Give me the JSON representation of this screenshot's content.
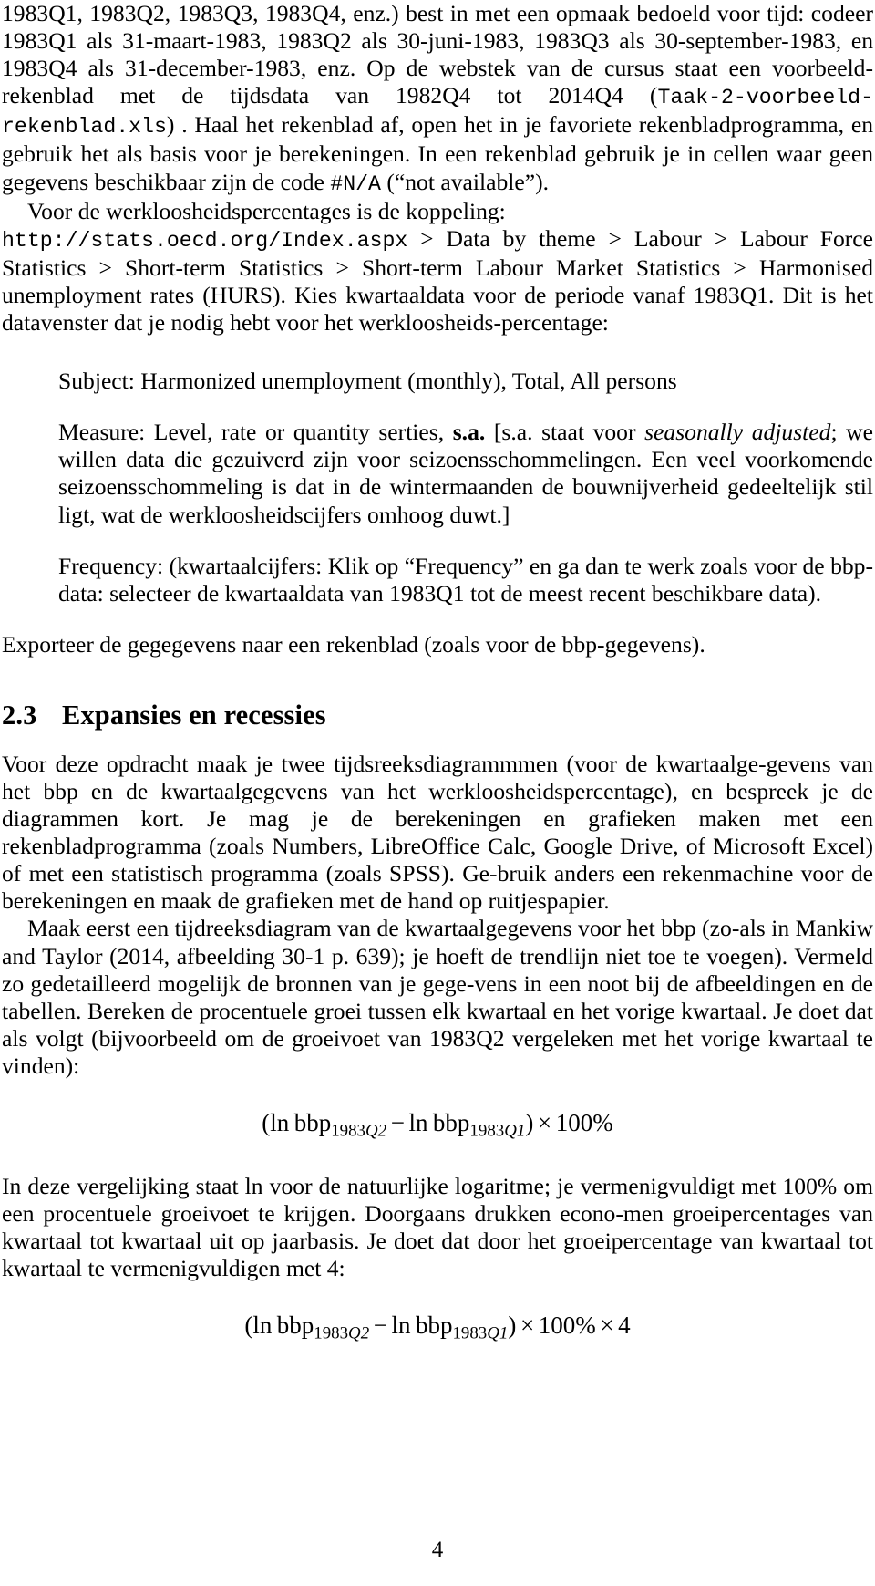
{
  "document": {
    "language": "nl",
    "page_number": "4"
  },
  "content": {
    "para_continued_1": {
      "part_a": "1983Q1, 1983Q2, 1983Q3, 1983Q4, enz.) best in met een opmaak bedoeld voor tijd: codeer 1983Q1 als 31-maart-1983, 1983Q2 als 30-juni-1983, 1983Q3 als 30-september-1983, en 1983Q4 als 31-december-1983, enz. Op de webstek van de cursus staat een voorbeeld-rekenblad met de tijdsdata van 1982Q4 tot 2014Q4 (",
      "code_filename": "Taak-2-voorbeeld-rekenblad.xls",
      "part_b": ") . Haal het rekenblad af, open het in je favoriete rekenbladprogramma, en gebruik het als basis voor je berekeningen. In een rekenblad gebruik je in cellen waar geen gegevens beschikbaar zijn de code ",
      "code_na": "#N/A",
      "part_c": " (“not available”)."
    },
    "para_link": {
      "lead": "Voor de werkloosheidspercentages is de koppeling:",
      "url": "http://stats.oecd.org/Index.aspx",
      "breadcrumb": " > Data by theme > Labour > Labour Force Statistics > Short-term Statistics > Short-term Labour Market Statistics > Harmonised unemployment rates (HURS). Kies kwartaaldata voor de periode vanaf 1983Q1. Dit is het datavenster dat je nodig hebt voor het werkloosheids-percentage:"
    },
    "spec_block": {
      "subject": "Subject: Harmonized unemployment (monthly), Total, All persons",
      "measure_part_a": "Measure: Level, rate or quantity serties, ",
      "measure_bold": "s.a.",
      "measure_part_b": " [s.a. staat voor ",
      "measure_italic": "seasonally adjusted",
      "measure_part_c": "; we willen data die gezuiverd zijn voor seizoensschommelingen. Een veel voorkomende seizoensschommeling is dat in de wintermaanden de bouwnijverheid gedeeltelijk stil ligt, wat de werkloosheidscijfers omhoog duwt.]",
      "frequency": "Frequency: (kwartaalcijfers: Klik op “Frequency” en ga dan te werk zoals voor de bbp-data: selecteer de kwartaaldata van 1983Q1 tot de meest recent beschikbare data)."
    },
    "para_export": "Exporteer de gegegevens naar een rekenblad (zoals voor de bbp-gegevens).",
    "section": {
      "number": "2.3",
      "title": "Expansies en recessies"
    },
    "para_assignment": "Voor deze opdracht maak je twee tijdsreeksdiagrammmen (voor de kwartaalge-gevens van het bbp en de kwartaalgegevens van het werkloosheidspercentage), en bespreek je de diagrammen kort. Je mag je de berekeningen en grafieken maken met een rekenbladprogramma (zoals Numbers, LibreOffice Calc, Google Drive, of Microsoft Excel) of met een statistisch programma (zoals SPSS). Ge-bruik anders een rekenmachine voor de berekeningen en maak de grafieken met de hand op ruitjespapier.",
    "para_timeseries": "Maak eerst een tijdreeksdiagram van de kwartaalgegevens voor het bbp (zo-als in Mankiw and Taylor (2014, afbeelding 30-1 p. 639); je hoeft de trendlijn niet toe te voegen). Vermeld zo gedetailleerd mogelijk de bronnen van je gege-vens in een noot bij de afbeeldingen en de tabellen. Bereken de procentuele groei tussen elk kwartaal en het vorige kwartaal. Je doet dat als volgt (bijvoorbeeld om de groeivoet van 1983Q2 vergeleken met het vorige kwartaal te vinden):",
    "formula_1": {
      "open_paren": "(",
      "ln_1": "ln",
      "var_1": "bbp",
      "sub_1_num": "1983",
      "sub_1_q": "Q",
      "sub_1_idx": "2",
      "minus": "−",
      "ln_2": "ln",
      "var_2": "bbp",
      "sub_2_num": "1983",
      "sub_2_q": "Q",
      "sub_2_idx": "1",
      "close_paren": ")",
      "times": "×",
      "value": "100%"
    },
    "para_explain": "In deze vergelijking staat ln voor de natuurlijke logaritme; je vermenigvuldigt met 100% om een procentuele groeivoet te krijgen. Doorgaans drukken econo-men groeipercentages van kwartaal tot kwartaal uit op jaarbasis. Je doet dat door het groeipercentage van kwartaal tot kwartaal te vermenigvuldigen met 4:",
    "formula_2": {
      "open_paren": "(",
      "ln_1": "ln",
      "var_1": "bbp",
      "sub_1_num": "1983",
      "sub_1_q": "Q",
      "sub_1_idx": "2",
      "minus": "−",
      "ln_2": "ln",
      "var_2": "bbp",
      "sub_2_num": "1983",
      "sub_2_q": "Q",
      "sub_2_idx": "1",
      "close_paren": ")",
      "times_1": "×",
      "value": "100%",
      "times_2": "×",
      "multiplier": "4"
    }
  }
}
